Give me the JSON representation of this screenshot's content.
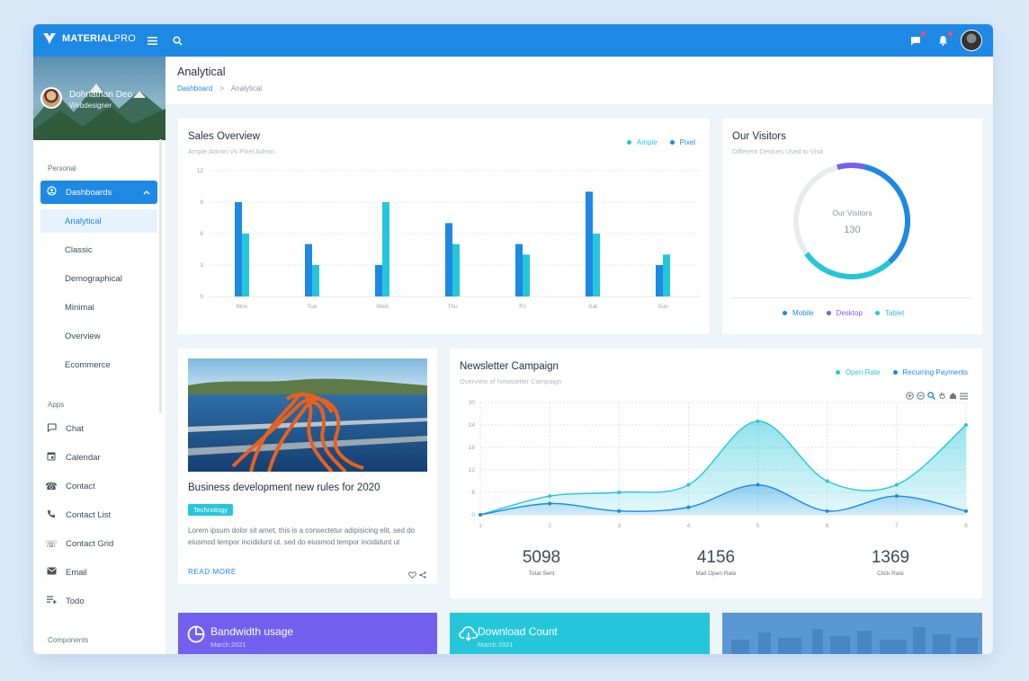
{
  "app": {
    "logo_bold": "MATERIAL",
    "logo_light": "PRO"
  },
  "user": {
    "name": "Dohnathan Deo",
    "role": "Webdesigner"
  },
  "sidebar": {
    "section_personal": "Personal",
    "dashboards_label": "Dashboards",
    "sub_items": [
      "Analytical",
      "Classic",
      "Demographical",
      "Minimal",
      "Overview",
      "Ecommerce"
    ],
    "section_apps": "Apps",
    "apps": [
      "Chat",
      "Calendar",
      "Contact",
      "Contact List",
      "Contact Grid",
      "Email",
      "Todo"
    ],
    "section_components": "Components"
  },
  "header": {
    "title": "Analytical",
    "breadcrumb_home": "Dashboard",
    "breadcrumb_sep": ">",
    "breadcrumb_current": "Analytical"
  },
  "sales": {
    "title": "Sales Overview",
    "subtitle": "Ample Admin Vs Pixel Admin",
    "legend": [
      "Ample",
      "Pixel"
    ]
  },
  "visitors": {
    "title": "Our Visitors",
    "subtitle": "Different Devices Used to Visit",
    "center_label": "Our Visitors",
    "center_value": "130",
    "legend": [
      "Mobile",
      "Desktop",
      "Tablet"
    ]
  },
  "blog": {
    "title": "Business development new rules for 2020",
    "tag": "Technology",
    "text": "Lorem ipsum dolor sit amet, this is a consectetur adipisicing elit, sed do eiusmod tempor incididunt ut. sed do eiusmod tempor incididunt ut",
    "read_more": "READ MORE"
  },
  "newsletter": {
    "title": "Newsletter Campaign",
    "subtitle": "Overview of Newsletter Campaign",
    "legend": [
      "Open Rate",
      "Recurring Payments"
    ],
    "stats": [
      {
        "value": "5098",
        "label": "Total Sent"
      },
      {
        "value": "4156",
        "label": "Mail Open Rate"
      },
      {
        "value": "1369",
        "label": "Click Rate"
      }
    ]
  },
  "bottom": {
    "bandwidth_title": "Bandwidth usage",
    "bandwidth_date": "March 2021",
    "download_title": "Download Count",
    "download_date": "March 2021"
  },
  "colors": {
    "primary": "#1e88e5",
    "cyan": "#26c6da",
    "purple": "#7460ee",
    "gray": "#e9ecef"
  },
  "chart_data": [
    {
      "type": "bar",
      "categories": [
        "Mon",
        "Tue",
        "Wed",
        "Thu",
        "Fri",
        "Sat",
        "Sun"
      ],
      "series": [
        {
          "name": "Ample",
          "values": [
            9,
            5,
            3,
            7,
            5,
            10,
            3
          ]
        },
        {
          "name": "Pixel",
          "values": [
            6,
            3,
            9,
            5,
            4,
            6,
            4
          ]
        }
      ],
      "yticks": [
        "0",
        "3",
        "6",
        "9",
        "12"
      ],
      "ylim": [
        0,
        12
      ],
      "title": "Sales Overview"
    },
    {
      "type": "pie",
      "categories": [
        "Mobile",
        "Desktop",
        "Tablet"
      ],
      "values": [
        45,
        10,
        35
      ],
      "title": "Our Visitors"
    },
    {
      "type": "area",
      "x": [
        1,
        2,
        3,
        4,
        5,
        6,
        7,
        8
      ],
      "series": [
        {
          "name": "Open Rate",
          "values": [
            0,
            5,
            6,
            8,
            25,
            9,
            8,
            24
          ]
        },
        {
          "name": "Recurring Payments",
          "values": [
            0,
            3,
            1,
            2,
            8,
            1,
            5,
            1
          ]
        }
      ],
      "yticks": [
        "0",
        "6",
        "12",
        "18",
        "24",
        "30"
      ],
      "xticks": [
        "1",
        "2",
        "3",
        "4",
        "5",
        "6",
        "7",
        "8"
      ],
      "ylim": [
        0,
        30
      ],
      "title": "Newsletter Campaign"
    }
  ]
}
